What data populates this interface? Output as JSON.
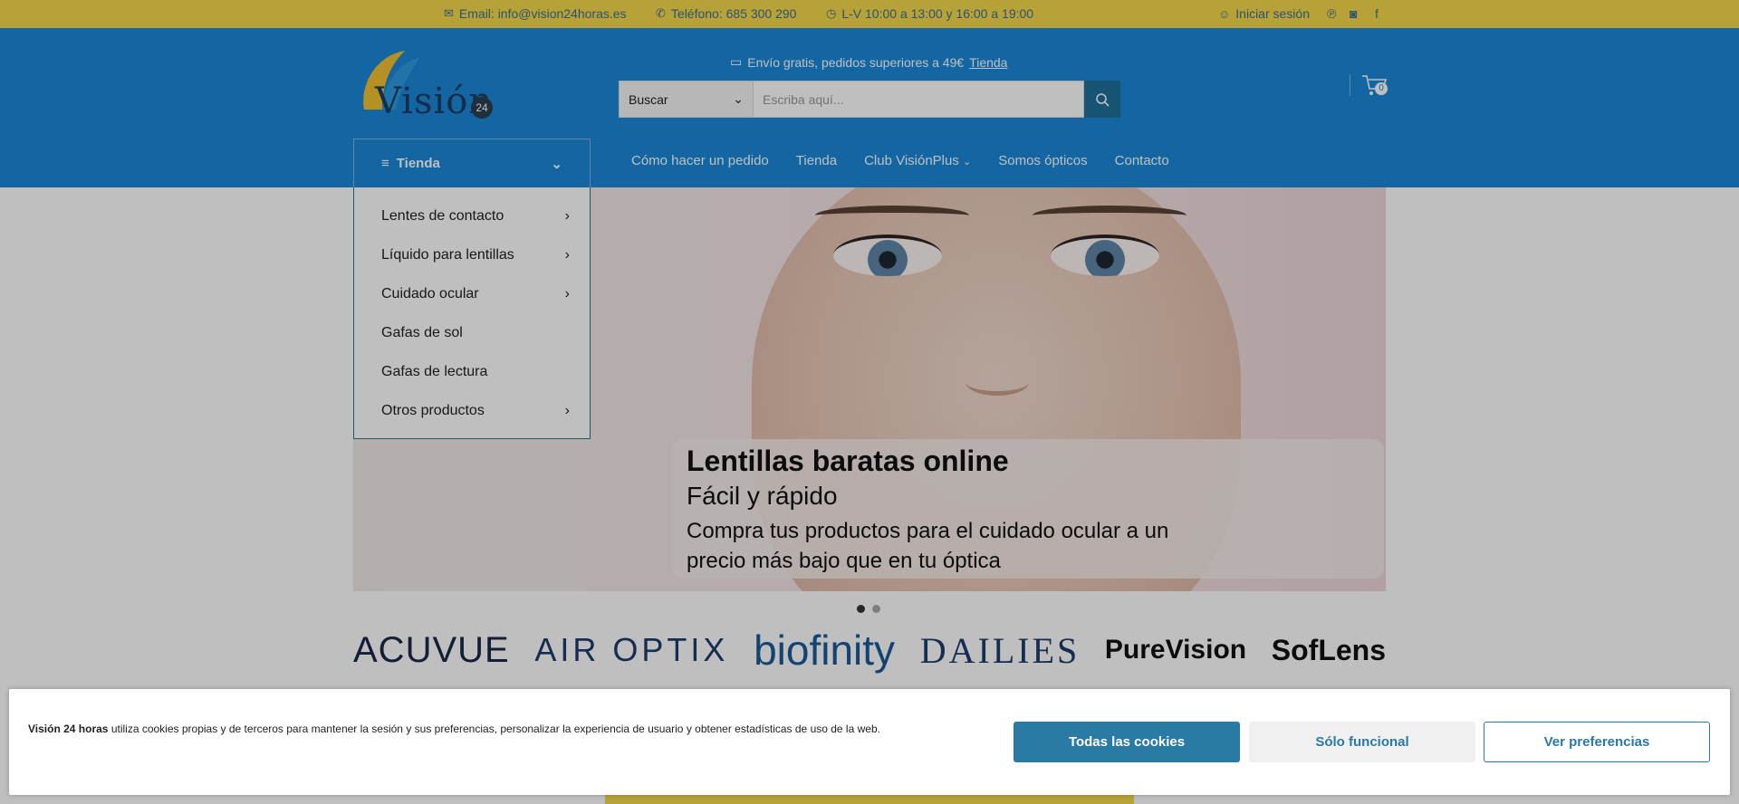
{
  "topbar": {
    "email": "Email: info@vision24horas.es",
    "phone": "Teléfono: 685 300 290",
    "hours": "L-V 10:00 a 13:00 y 16:00 a 19:00",
    "login": "Iniciar sesión"
  },
  "header": {
    "logo_text": "Visión",
    "logo_number": "24",
    "promo_text": "Envío gratis, pedidos superiores a 49€",
    "promo_link": "Tienda",
    "search_category": "Buscar",
    "search_placeholder": "Escriba aquí...",
    "cart_count": "0"
  },
  "nav": {
    "category_button": "Tienda",
    "items": [
      "Cómo hacer un pedido",
      "Tienda",
      "Club VisiónPlus",
      "Somos ópticos",
      "Contacto"
    ]
  },
  "dropdown": {
    "items": [
      {
        "label": "Lentes de contacto",
        "has_sub": true
      },
      {
        "label": "Líquido para lentillas",
        "has_sub": true
      },
      {
        "label": "Cuidado ocular",
        "has_sub": true
      },
      {
        "label": "Gafas de sol",
        "has_sub": false
      },
      {
        "label": "Gafas de lectura",
        "has_sub": false
      },
      {
        "label": "Otros productos",
        "has_sub": true
      }
    ]
  },
  "hero": {
    "title": "Lentillas baratas online",
    "subtitle": "Fácil y rápido",
    "text": "Compra tus productos para el cuidado ocular a un precio más bajo que en tu óptica"
  },
  "brands": [
    "ACUVUE",
    "AIR OPTIX",
    "biofinity",
    "DAILIES",
    "PureVision",
    "SofLens"
  ],
  "cookie": {
    "brand": "Visión 24 horas",
    "text": " utiliza cookies propias y de terceros para mantener la sesión y sus preferencias, personalizar la experiencia de usuario y obtener estadísticas de uso de la web.",
    "btn_all": "Todas las cookies",
    "btn_functional": "Sólo funcional",
    "btn_prefs": "Ver preferencias"
  },
  "colors": {
    "topbar": "#f4d84a",
    "header": "#1a88d9",
    "accent": "#2a7aa6"
  }
}
